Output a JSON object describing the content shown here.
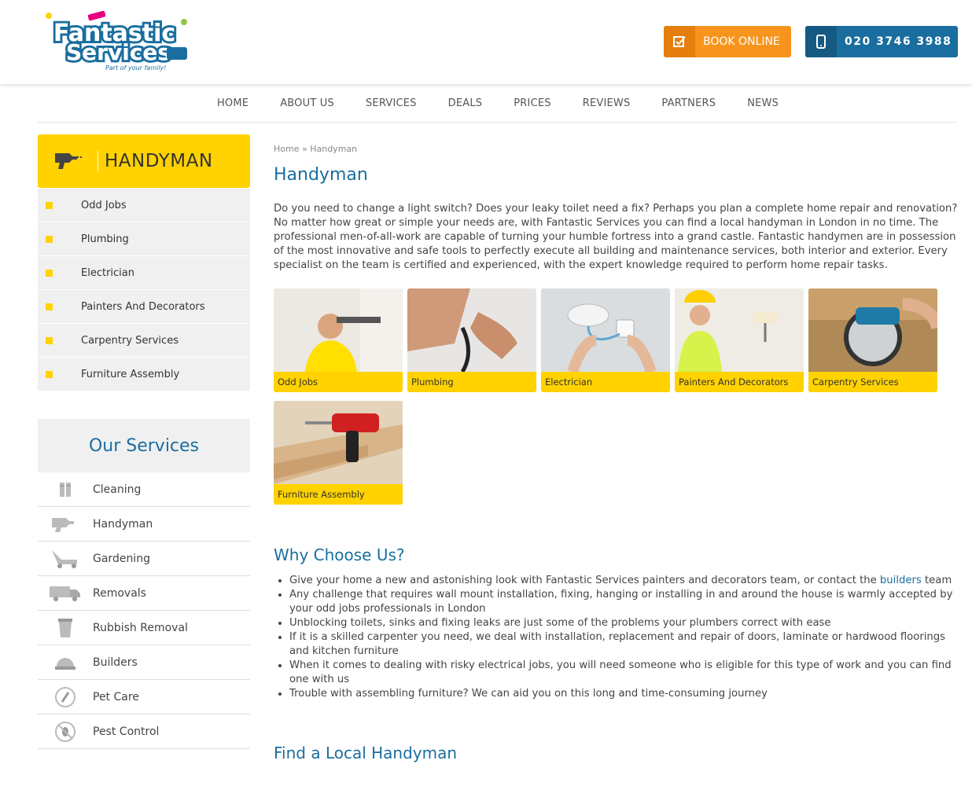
{
  "header": {
    "logo_line1": "Fantastic",
    "logo_line2": "Services",
    "logo_tagline": "Part of your family!",
    "book_label": "BOOK ONLINE",
    "phone_label": "020 3746 3988"
  },
  "nav": [
    "HOME",
    "ABOUT US",
    "SERVICES",
    "DEALS",
    "PRICES",
    "REVIEWS",
    "PARTNERS",
    "NEWS"
  ],
  "sidebar": {
    "title": "HANDYMAN",
    "sub_items": [
      "Odd Jobs",
      "Plumbing",
      "Electrician",
      "Painters And Decorators",
      "Carpentry Services",
      "Furniture Assembly"
    ],
    "services_title": "Our Services",
    "services": [
      "Cleaning",
      "Handyman",
      "Gardening",
      "Removals",
      "Rubbish Removal",
      "Builders",
      "Pet Care",
      "Pest Control"
    ]
  },
  "main": {
    "breadcrumb_home": "Home",
    "breadcrumb_sep": " » ",
    "breadcrumb_current": "Handyman",
    "title": "Handyman",
    "intro": "Do you need to change a light switch? Does your leaky toilet need a fix? Perhaps you plan a complete home repair and renovation? No matter how great or simple your needs are, with Fantastic Services you can find a local handyman in London in no time. The professional men-of-all-work are capable of turning your humble fortress into a grand castle. Fantastic handymen are in possession of the most innovative and safe tools to perfectly execute all building and maintenance services, both interior and exterior. Every specialist on the team is certified and experienced, with the expert knowledge required to perform home repair tasks.",
    "cards": [
      "Odd Jobs",
      "Plumbing",
      "Electrician",
      "Painters And Decorators",
      "Carpentry Services",
      "Furniture Assembly"
    ],
    "why_title": "Why Choose Us?",
    "why_1a": "Give your home a new and astonishing look with Fantastic Services painters and decorators team, or contact the ",
    "why_1link": "builders",
    "why_1b": " team",
    "why_2": "Any challenge that requires wall mount installation, fixing, hanging or installing in and around the house is warmly accepted by your odd jobs professionals in London",
    "why_3": "Unblocking toilets, sinks and fixing leaks are just some of the problems your plumbers correct with ease",
    "why_4": "If it is a skilled carpenter you need, we deal with installation, replacement and repair of doors, laminate or hardwood floorings and kitchen furniture",
    "why_5": "When it comes to dealing with risky electrical jobs, you will need someone who is eligible for this type of work and you can find one with us",
    "why_6": "Trouble with assembling furniture? We can aid you on this long and time-consuming journey",
    "find_title": "Find a Local Handyman"
  },
  "colors": {
    "accent_yellow": "#ffd200",
    "brand_blue": "#1a6e9f",
    "book_orange": "#f7941d"
  }
}
